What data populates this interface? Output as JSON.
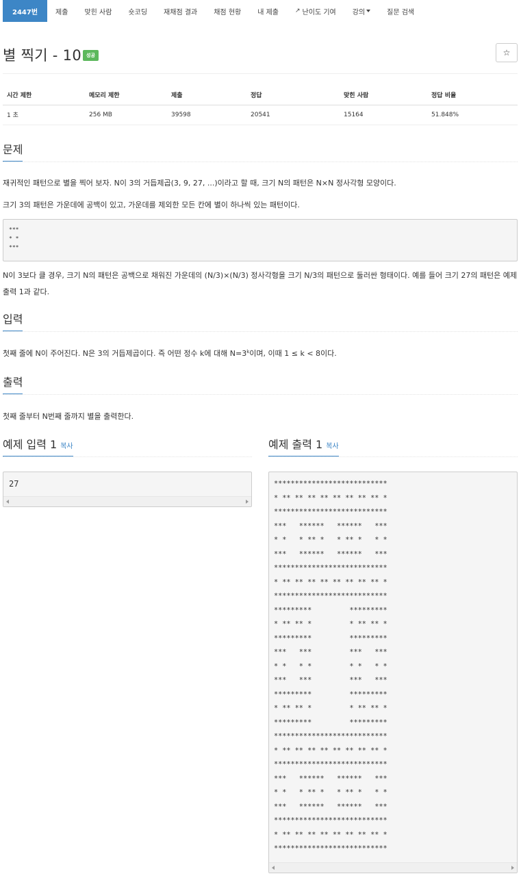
{
  "nav": {
    "problem_number": "2447번",
    "items": [
      "제출",
      "맞힌 사람",
      "숏코딩",
      "재채점 결과",
      "채점 현황",
      "내 제출"
    ],
    "difficulty": "난이도 기여",
    "lecture": "강의",
    "qna": "질문 검색"
  },
  "problem": {
    "title": "별 찍기 - 10",
    "badge": "성공",
    "star": "☆"
  },
  "info": {
    "headers": [
      "시간 제한",
      "메모리 제한",
      "제출",
      "정답",
      "맞힌 사람",
      "정답 비율"
    ],
    "values": [
      "1 초",
      "256 MB",
      "39598",
      "20541",
      "15164",
      "51.848%"
    ]
  },
  "sections": {
    "problem": "문제",
    "input": "입력",
    "output": "출력",
    "sample_input": "예제 입력 1",
    "sample_output": "예제 출력 1",
    "copy": "복사"
  },
  "description": {
    "p1": "재귀적인 패턴으로 별을 찍어 보자. N이 3의 거듭제곱(3, 9, 27, ...)이라고 할 때, 크기 N의 패턴은 N×N 정사각형 모양이다.",
    "p2": "크기 3의 패턴은 가운데에 공백이 있고, 가운데를 제외한 모든 칸에 별이 하나씩 있는 패턴이다.",
    "pattern3": "***\n* *\n***",
    "p3": "N이 3보다 클 경우, 크기 N의 패턴은 공백으로 채워진 가운데의 (N/3)×(N/3) 정사각형을 크기 N/3의 패턴으로 둘러싼 형태이다. 예를 들어 크기 27의 패턴은 예제 출력 1과 같다."
  },
  "input_desc": {
    "before": "첫째 줄에 N이 주어진다. N은 3의 거듭제곱이다. 즉 어떤 정수 k에 대해 N=3",
    "sup": "k",
    "after": "이며, 이때 1 ≤ k < 8이다."
  },
  "output_desc": "첫째 줄부터 N번째 줄까지 별을 출력한다.",
  "sample_input": "27",
  "sample_output": "***************************\n* ** ** ** ** ** ** ** ** *\n***************************\n***   ******   ******   ***\n* *   * ** *   * ** *   * *\n***   ******   ******   ***\n***************************\n* ** ** ** ** ** ** ** ** *\n***************************\n*********         *********\n* ** ** *         * ** ** *\n*********         *********\n***   ***         ***   ***\n* *   * *         * *   * *\n***   ***         ***   ***\n*********         *********\n* ** ** *         * ** ** *\n*********         *********\n***************************\n* ** ** ** ** ** ** ** ** *\n***************************\n***   ******   ******   ***\n* *   * ** *   * ** *   * *\n***   ******   ******   ***\n***************************\n* ** ** ** ** ** ** ** ** *\n***************************"
}
